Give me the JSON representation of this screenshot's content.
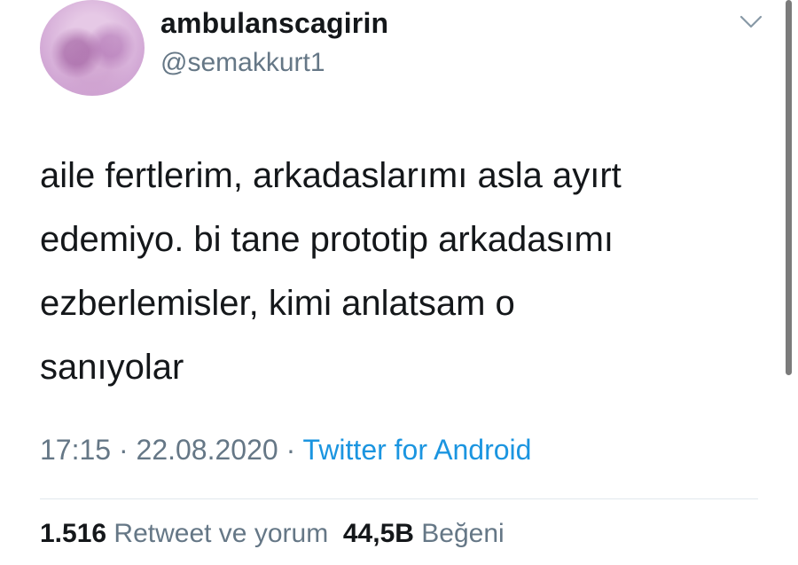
{
  "author": {
    "display_name": "ambulanscagirin",
    "handle": "@semakkurt1"
  },
  "tweet": {
    "lines": [
      "aile fertlerim, arkadaslarımı asla ayırt",
      "edemiyo. bi tane prototip arkadasımı",
      "ezberlemisler, kimi anlatsam o",
      "sanıyolar"
    ]
  },
  "meta": {
    "time": "17:15",
    "separator": " · ",
    "date": "22.08.2020",
    "separator2": " · ",
    "source": "Twitter for Android"
  },
  "stats": {
    "retweets_count": "1.516",
    "retweets_label": "Retweet ve yorum",
    "likes_count": "44,5B",
    "likes_label": "Beğeni"
  },
  "icons": {
    "menu": "chevron-down-icon"
  },
  "colors": {
    "text": "#14171a",
    "secondary": "#657786",
    "link": "#1b95e0"
  }
}
